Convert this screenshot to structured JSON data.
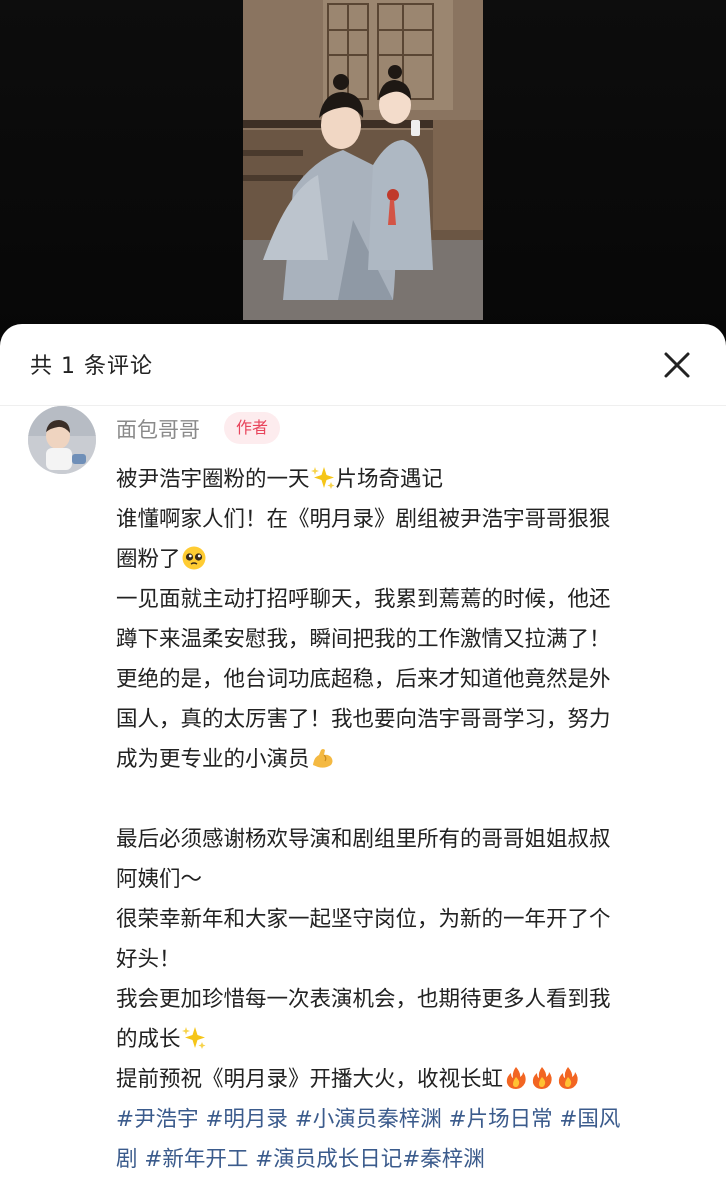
{
  "sheet": {
    "comment_count_label": "共 1 条评论",
    "close_icon": "close-icon"
  },
  "comment": {
    "username": "面包哥哥",
    "author_badge": "作者",
    "lines": [
      "被尹浩宇圈粉的一天",
      "片场奇遇记",
      "谁懂啊家人们！在《明月录》剧组被尹浩宇哥哥狠狠",
      "圈粉了",
      "一见面就主动打招呼聊天，我累到蔫蔫的时候，他还",
      "蹲下来温柔安慰我，瞬间把我的工作激情又拉满了！",
      "更绝的是，他台词功底超稳，后来才知道他竟然是外",
      "国人，真的太厉害了！我也要向浩宇哥哥学习，努力",
      "成为更专业的小演员",
      "最后必须感谢杨欢导演和剧组里所有的哥哥姐姐叔叔",
      "阿姨们～",
      "很荣幸新年和大家一起坚守岗位，为新的一年开了个",
      "好头！",
      "我会更加珍惜每一次表演机会，也期待更多人看到我",
      "的成长",
      "提前预祝《明月录》开播大火，收视长虹"
    ],
    "tag_lines": [
      "#尹浩宇 #明月录 #小演员秦梓渊 #片场日常 #国风",
      "剧 #新年开工 #演员成长日记#秦梓渊"
    ],
    "emoji": {
      "sparkles": "sparkles-icon",
      "pleading": "pleading-face-icon",
      "muscle": "flexed-biceps-icon",
      "fire": "fire-icon"
    }
  }
}
